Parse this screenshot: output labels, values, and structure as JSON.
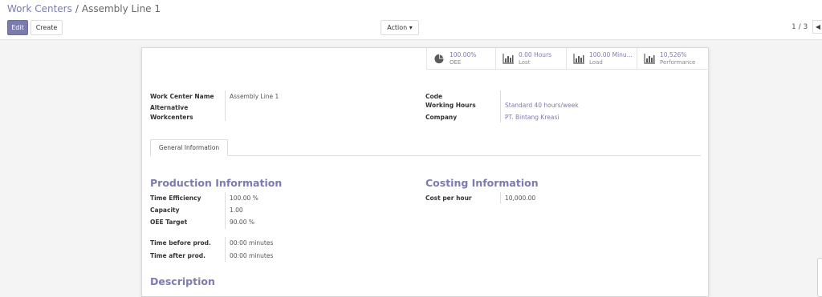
{
  "breadcrumb": {
    "parent": "Work Centers",
    "separator": "/",
    "current": "Assembly Line 1"
  },
  "toolbar": {
    "edit_label": "Edit",
    "create_label": "Create",
    "action_label": "Action ▾"
  },
  "pager": {
    "value": "1 / 3",
    "prev_icon": "chevron-left-icon"
  },
  "stats": [
    {
      "icon": "pie-chart-icon",
      "value": "100.00%",
      "label": "OEE"
    },
    {
      "icon": "bar-chart-icon",
      "value": "0.00 Hours",
      "label": "Lost"
    },
    {
      "icon": "bar-chart-icon",
      "value": "100.00 Minu...",
      "label": "Load"
    },
    {
      "icon": "bar-chart-icon",
      "value": "10,526%",
      "label": "Performance"
    }
  ],
  "fields": {
    "work_center_name_label": "Work Center Name",
    "work_center_name_value": "Assembly Line 1",
    "alternative_label_1": "Alternative",
    "alternative_label_2": "Workcenters",
    "code_label": "Code",
    "working_hours_label": "Working Hours",
    "working_hours_value": "Standard 40 hours/week",
    "company_label": "Company",
    "company_value": "PT. Bintang Kreasi"
  },
  "tab": {
    "label": "General Information"
  },
  "production": {
    "title": "Production Information",
    "time_efficiency_label": "Time Efficiency",
    "time_efficiency_value": "100.00 %",
    "capacity_label": "Capacity",
    "capacity_value": "1.00",
    "oee_target_label": "OEE Target",
    "oee_target_value": "90.00 %",
    "time_before_label": "Time before prod.",
    "time_before_value": "00:00 minutes",
    "time_after_label": "Time after prod.",
    "time_after_value": "00:00 minutes"
  },
  "costing": {
    "title": "Costing Information",
    "cost_per_hour_label": "Cost per hour",
    "cost_per_hour_value": "10,000.00"
  },
  "description": {
    "title": "Description"
  },
  "colors": {
    "accent": "#7c7bad",
    "background": "#f4f4f5"
  }
}
